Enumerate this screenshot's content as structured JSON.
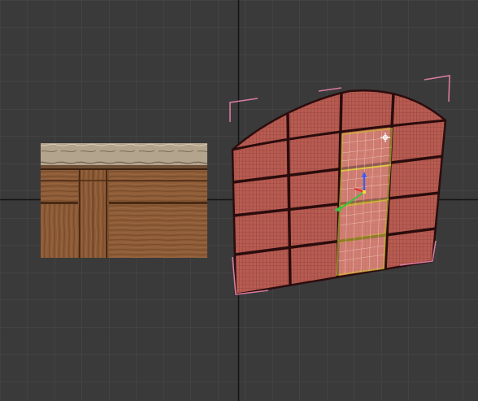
{
  "viewport": {
    "background_color": "#3a3a3a",
    "grid_minor_color": "#4a4a4a",
    "grid_major_color": "#141414",
    "show_grid": true
  },
  "texture_preview": {
    "description_icon": "wood-plank-texture",
    "plank_color": "#8a5a36",
    "plank_dark_color": "#5a3218",
    "stone_color": "#b8a890"
  },
  "mesh_object": {
    "shape": "arched-wall-plane",
    "face_color": "#b85c52",
    "wire_color": "#3c1212",
    "selection_color": "#e8e040",
    "bounds_color": "#d87aa0",
    "columns": 4,
    "rows": 4,
    "selected_column": 2
  },
  "gizmo": {
    "type": "move-gizmo",
    "x_color": "#e83030",
    "y_color": "#40c040",
    "z_color": "#3060ff"
  }
}
